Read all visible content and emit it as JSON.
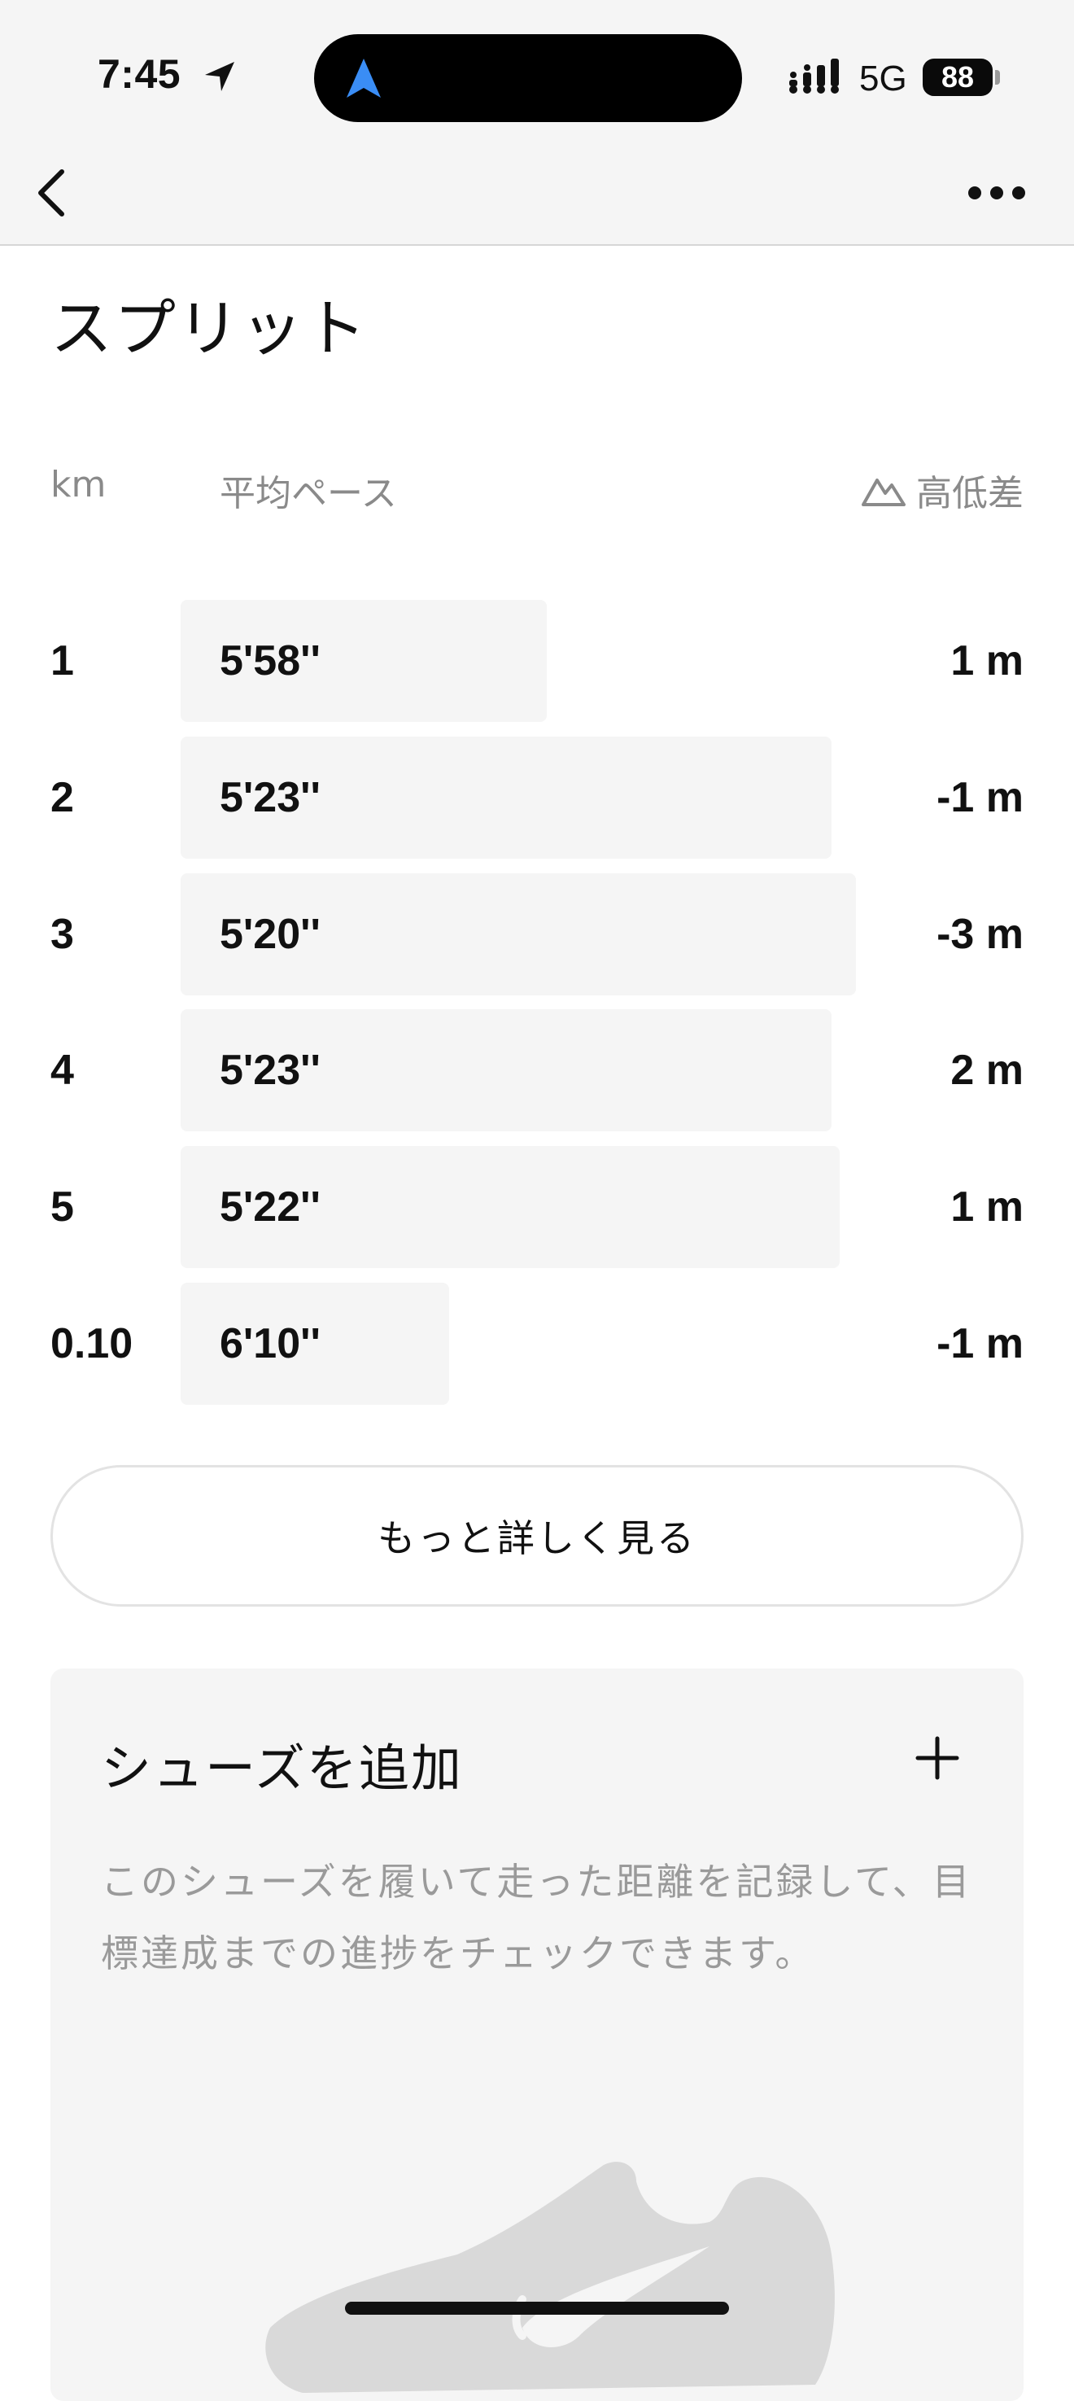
{
  "status_bar": {
    "time": "7:45",
    "network": "5G",
    "battery": "88"
  },
  "splits": {
    "title": "スプリット",
    "header_km": "km",
    "header_pace": "平均ペース",
    "header_elevation": "高低差",
    "rows": [
      {
        "km": "1",
        "pace": "5'58''",
        "elevation": "1 m",
        "pace_seconds": 358
      },
      {
        "km": "2",
        "pace": "5'23''",
        "elevation": "-1 m",
        "pace_seconds": 323
      },
      {
        "km": "3",
        "pace": "5'20''",
        "elevation": "-3 m",
        "pace_seconds": 320
      },
      {
        "km": "4",
        "pace": "5'23''",
        "elevation": "2 m",
        "pace_seconds": 323
      },
      {
        "km": "5",
        "pace": "5'22''",
        "elevation": "1 m",
        "pace_seconds": 322
      },
      {
        "km": "0.10",
        "pace": "6'10''",
        "elevation": "-1 m",
        "pace_seconds": 370
      }
    ],
    "more_button_label": "もっと詳しく見る"
  },
  "shoes": {
    "title": "シューズを追加",
    "add_icon": "plus-icon",
    "description_line1": "このシューズを履いて走った距離を記録して、目",
    "description_line2": "標達成までの進捗をチェックできます。"
  },
  "colors": {
    "bar_background": "#f5f5f5",
    "accent_blue": "#3a8df5",
    "muted_text": "#9a9a9a"
  }
}
